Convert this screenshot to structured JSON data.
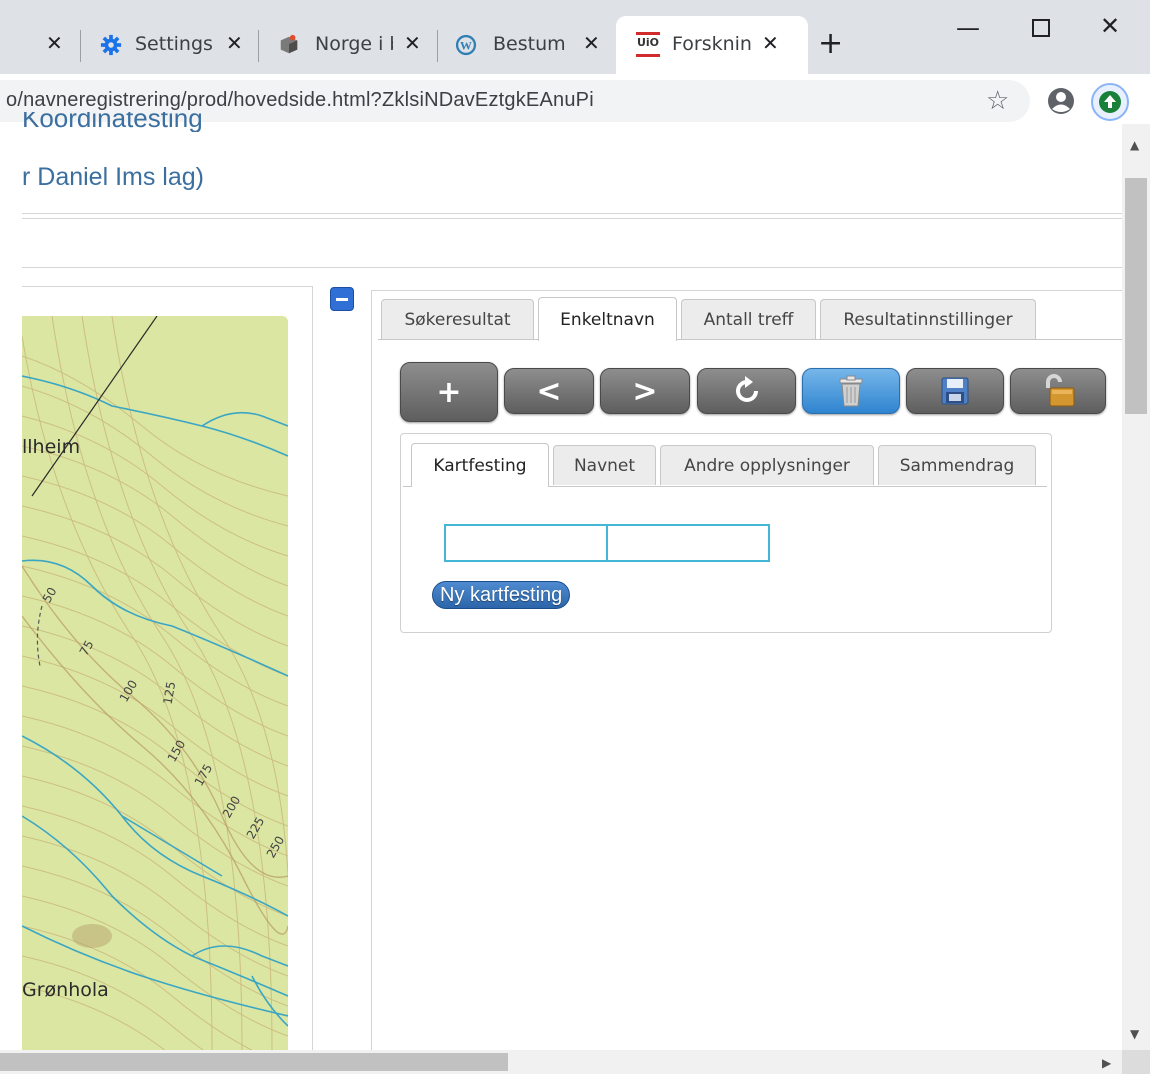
{
  "browser": {
    "tabs": [
      {
        "title": "",
        "active": false
      },
      {
        "title": "Settings",
        "active": false
      },
      {
        "title": "Norge i b",
        "active": false
      },
      {
        "title": "Bestum s",
        "active": false
      },
      {
        "title": "Forskning",
        "active": true
      }
    ],
    "new_tab_symbol": "+",
    "close_symbol": "✕",
    "url": "o/navneregistrering/prod/hovedside.html?ZklsiNDavEztgkEAnuPi",
    "window_controls": {
      "minimize": "—",
      "maximize": "☐",
      "close": "✕"
    },
    "star_symbol": "☆",
    "uio_favicon_text": "UiO"
  },
  "page": {
    "cut_heading": "Koordinatesting",
    "subtitle": "r Daniel Ims lag)"
  },
  "map": {
    "labels": {
      "place1": "llheim",
      "place2": "Grønhola"
    },
    "contours": [
      "50",
      "75",
      "100",
      "125",
      "150",
      "175",
      "200",
      "225",
      "250"
    ]
  },
  "result_tabs": [
    {
      "label": "Søkeresultat",
      "active": false
    },
    {
      "label": "Enkeltnavn",
      "active": true
    },
    {
      "label": "Antall treff",
      "active": false
    },
    {
      "label": "Resultatinnstillinger",
      "active": false
    }
  ],
  "toolbar": {
    "add": "+",
    "prev": "<",
    "next": ">"
  },
  "detail_tabs": [
    {
      "label": "Kartfesting",
      "active": true
    },
    {
      "label": "Navnet",
      "active": false
    },
    {
      "label": "Andre opplysninger",
      "active": false
    },
    {
      "label": "Sammendrag",
      "active": false
    }
  ],
  "coord_fields": {
    "first": "",
    "second": ""
  },
  "new_mapping_button": "Ny kartfesting",
  "colors": {
    "accent_blue": "#2f84cf",
    "link_blue": "#3b6fa0",
    "map_green": "#dbe6a2",
    "river": "#3aa6c4",
    "field_border": "#45b7d6"
  }
}
